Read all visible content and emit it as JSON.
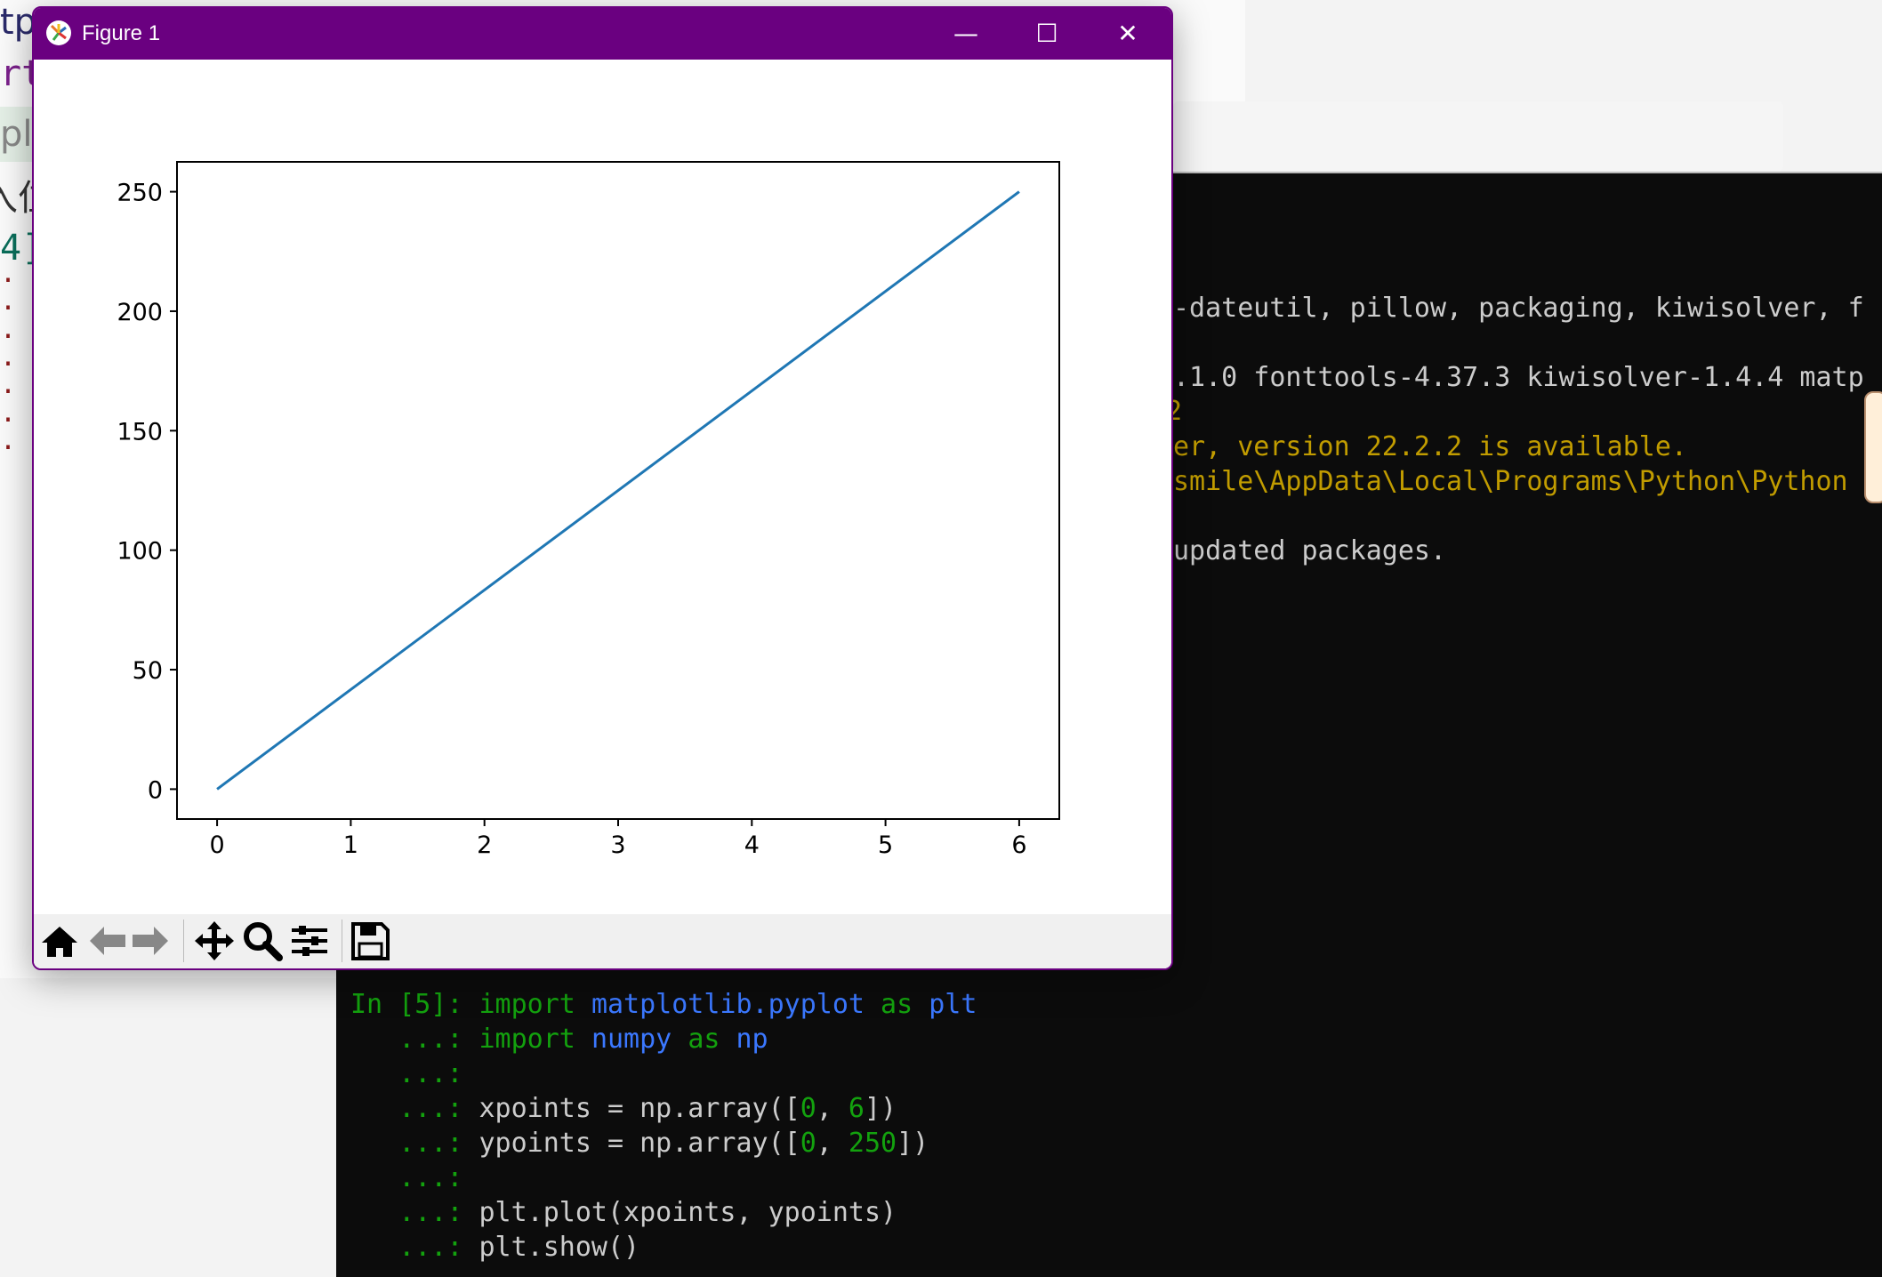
{
  "background_page": {
    "fragments": [
      "tp",
      "rt",
      "pl",
      "入位",
      "4]"
    ],
    "dots": "..."
  },
  "terminal": {
    "output_lines": [
      {
        "text": "-dateutil, pillow, packaging, kiwisolver, f",
        "color": "#cccccc"
      },
      {
        "text": ".1.0 fonttools-4.37.3 kiwisolver-1.4.4 matp",
        "color": "#cccccc"
      },
      {
        "text": "2",
        "color": "#c19c00"
      },
      {
        "text": "er, version 22.2.2 is available.",
        "color": "#c19c00"
      },
      {
        "text": "smile\\AppData\\Local\\Programs\\Python\\Python",
        "color": "#c19c00"
      },
      {
        "text": "updated packages.",
        "color": "#cccccc"
      }
    ],
    "prompt": "In [5]:",
    "continuation": "...:",
    "code": {
      "line1_kw": "import",
      "line1_mod": "matplotlib.pyplot",
      "line1_as": "as",
      "line1_alias": "plt",
      "line2_kw": "import",
      "line2_mod": "numpy",
      "line2_as": "as",
      "line2_alias": "np",
      "line4_pre": "xpoints = np.array([",
      "line4_a": "0",
      "line4_sep": ", ",
      "line4_b": "6",
      "line4_post": "])",
      "line5_pre": "ypoints = np.array([",
      "line5_a": "0",
      "line5_sep": ", ",
      "line5_b": "250",
      "line5_post": "])",
      "line7": "plt.plot(xpoints, ypoints)",
      "line8": "plt.show()"
    }
  },
  "figure_window": {
    "title": "Figure 1",
    "minimize": "—",
    "maximize": "☐",
    "close": "✕",
    "title_bar_color": "#6a0080",
    "toolbar": [
      {
        "name": "home-icon",
        "glyph": "⌂"
      },
      {
        "name": "back-icon",
        "glyph": "←"
      },
      {
        "name": "forward-icon",
        "glyph": "→"
      },
      {
        "name": "pan-icon",
        "glyph": "✥"
      },
      {
        "name": "zoom-icon",
        "glyph": "🔍"
      },
      {
        "name": "subplots-icon",
        "glyph": "☰"
      },
      {
        "name": "save-icon",
        "glyph": "💾"
      }
    ]
  },
  "chart_data": {
    "type": "line",
    "x": [
      0,
      6
    ],
    "series": [
      {
        "values": [
          0,
          250
        ],
        "color": "#1f77b4"
      }
    ],
    "xlim": [
      -0.3,
      6.3
    ],
    "ylim": [
      -12.5,
      262.5
    ],
    "xticks": [
      0,
      1,
      2,
      3,
      4,
      5,
      6
    ],
    "yticks": [
      0,
      50,
      100,
      150,
      200,
      250
    ],
    "grid": false,
    "title": "",
    "xlabel": "",
    "ylabel": ""
  }
}
